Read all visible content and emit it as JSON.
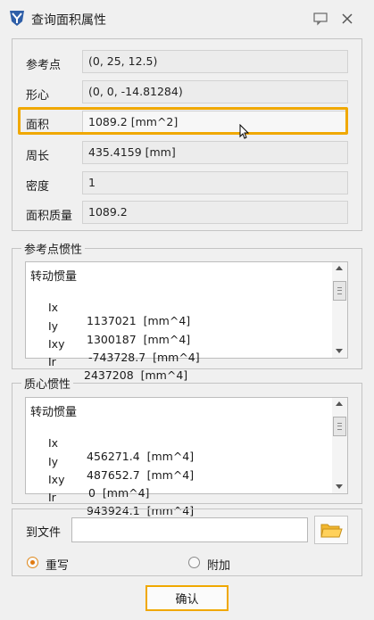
{
  "window": {
    "title": "查询面积属性"
  },
  "properties": [
    {
      "label": "参考点",
      "value": "(0, 25, 12.5)"
    },
    {
      "label": "形心",
      "value": "(0, 0, -14.81284)"
    },
    {
      "label": "面积",
      "value": "1089.2  [mm^2]"
    },
    {
      "label": "周长",
      "value": "435.4159  [mm]"
    },
    {
      "label": "密度",
      "value": "1"
    },
    {
      "label": "面积质量",
      "value": "1089.2"
    }
  ],
  "ref_inertia": {
    "title": "参考点惯性",
    "heading": "转动惯量",
    "lines": [
      {
        "name": "Ix",
        "value": "1137021  [mm^4]"
      },
      {
        "name": "Iy",
        "value": "1300187  [mm^4]"
      },
      {
        "name": "Ixy",
        "value": "-743728.7  [mm^4]"
      },
      {
        "name": "Ir",
        "value": "2437208  [mm^4]"
      }
    ]
  },
  "centroid_inertia": {
    "title": "质心惯性",
    "heading": "转动惯量",
    "lines": [
      {
        "name": "Ix",
        "value": "456271.4  [mm^4]"
      },
      {
        "name": "Iy",
        "value": "487652.7  [mm^4]"
      },
      {
        "name": "Ixy",
        "value": "0  [mm^4]"
      },
      {
        "name": "Ir",
        "value": "943924.1  [mm^4]"
      }
    ]
  },
  "export": {
    "label": "到文件",
    "file_value": "",
    "options": [
      {
        "label": "重写",
        "selected": true
      },
      {
        "label": "附加",
        "selected": false
      }
    ]
  },
  "ok_label": "确认",
  "colors": {
    "highlight": "#f0a800",
    "radio_selected": "#e07a10"
  }
}
